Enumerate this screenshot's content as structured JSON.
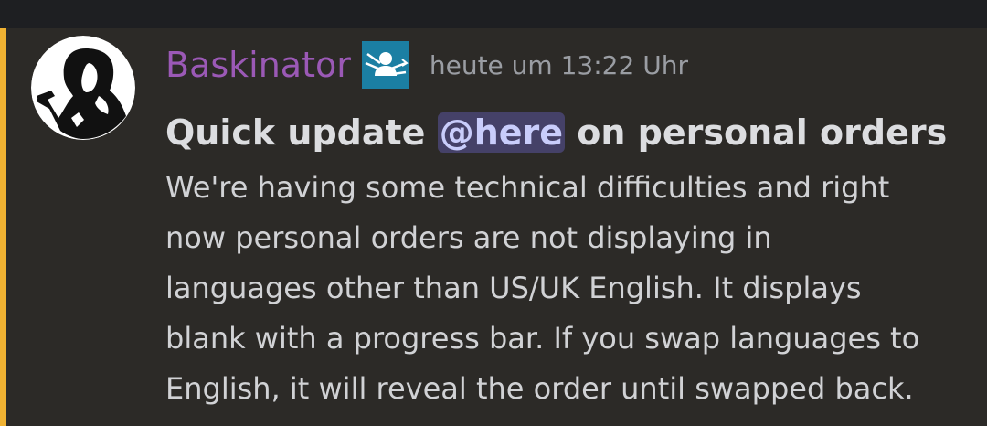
{
  "message": {
    "username": "Baskinator",
    "timestamp": "heute um 13:22 Uhr",
    "role_icon": "role-badge-icon",
    "title_before": "Quick update ",
    "mention": "@here",
    "title_after": " on personal orders",
    "body_lines": [
      "We're having some technical difficulties and right",
      "now personal orders are not displaying in",
      "languages other than US/UK English. It displays",
      "blank with a progress bar. If you swap languages to",
      "English, it will reveal the order until swapped back."
    ]
  },
  "colors": {
    "background": "#2c2a27",
    "topbar": "#1e1f22",
    "accent_bar": "#f0b232",
    "username": "#9b59b6",
    "mention_bg": "#454168",
    "role_icon_bg": "#1b7fa3"
  }
}
